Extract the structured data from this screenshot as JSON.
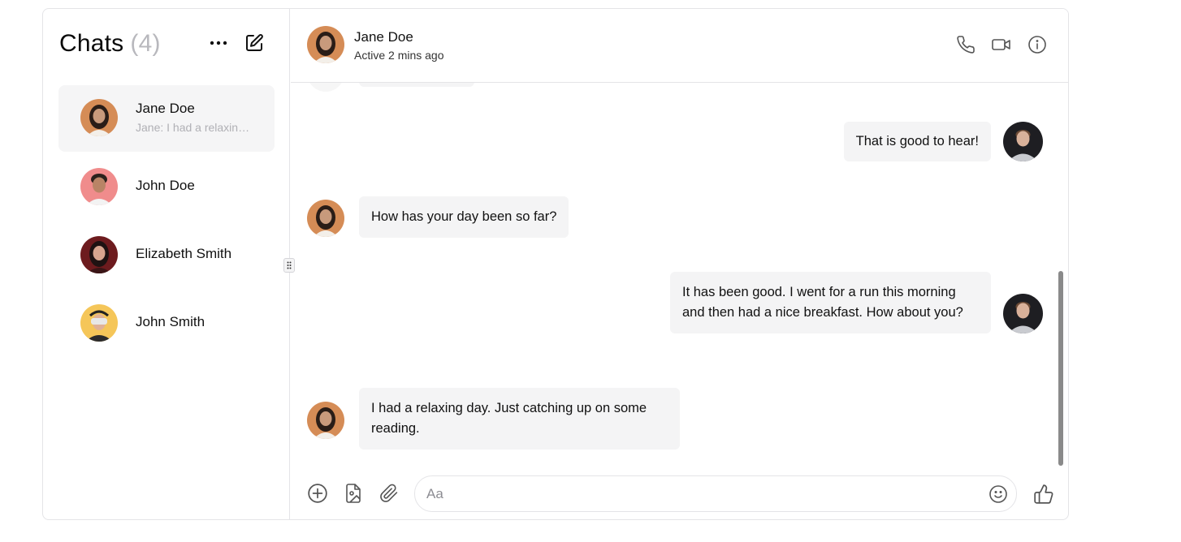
{
  "sidebar": {
    "title": "Chats",
    "count": "(4)",
    "chats": [
      {
        "name": "Jane Doe",
        "preview": "Jane: I had a relaxing day. Just catching up on some reading.",
        "active": true
      },
      {
        "name": "John Doe",
        "preview": "",
        "active": false
      },
      {
        "name": "Elizabeth Smith",
        "preview": "",
        "active": false
      },
      {
        "name": "John Smith",
        "preview": "",
        "active": false
      }
    ]
  },
  "header": {
    "name": "Jane Doe",
    "status": "Active 2 mins ago"
  },
  "messages": [
    {
      "from": "me",
      "text": "That is good to hear!"
    },
    {
      "from": "Jane Doe",
      "text": "How has your day been so far?"
    },
    {
      "from": "me",
      "text": "It has been good. I went for a run this morning and then had a nice breakfast. How about you?"
    },
    {
      "from": "Jane Doe",
      "text": "I had a relaxing day. Just catching up on some reading."
    }
  ],
  "composer": {
    "placeholder": "Aa",
    "value": ""
  },
  "colors": {
    "bubble": "#f4f4f5",
    "border": "#e4e4e7",
    "active_row": "#f5f5f6"
  }
}
